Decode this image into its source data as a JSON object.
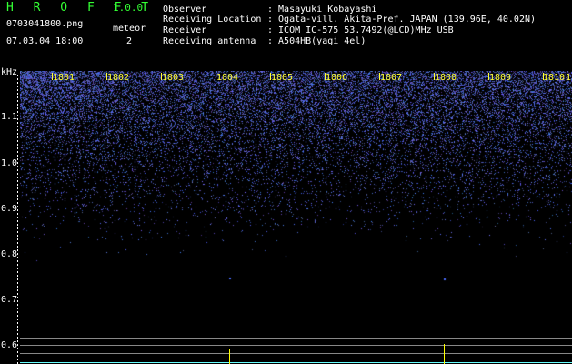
{
  "app": {
    "title": "H R O F F T",
    "version": "1.0.0",
    "filename": "0703041800.png",
    "datetime": "07.03.04 18:00",
    "meteor_label": "meteor",
    "meteor_count": "2"
  },
  "info": {
    "labels": [
      "Observer",
      "Receiving Location",
      "Receiver",
      "Receiving antenna"
    ],
    "values": [
      ": Masayuki Kobayashi",
      ": Ogata-vill. Akita-Pref. JAPAN (139.96E, 40.02N)",
      ": ICOM IC-575 53.7492(@LCD)MHz USB",
      ": A504HB(yagi 4el)"
    ]
  },
  "axes": {
    "y_unit": "kHz",
    "y_ticks": [
      "1.1",
      "1.0",
      "0.9",
      "0.8",
      "0.7",
      "0.6"
    ],
    "x_ticks": [
      "1801",
      "1802",
      "1803",
      "1804",
      "1805",
      "1806",
      "1807",
      "1808",
      "1809",
      "1810",
      "1"
    ]
  },
  "colors": {
    "background": "#000000",
    "noise": "#2a3cff",
    "title_green": "#33ff33",
    "tick_yellow": "#ffff33",
    "ping_yellow": "#ffff00",
    "baseline_cyan": "#66ffff"
  }
}
